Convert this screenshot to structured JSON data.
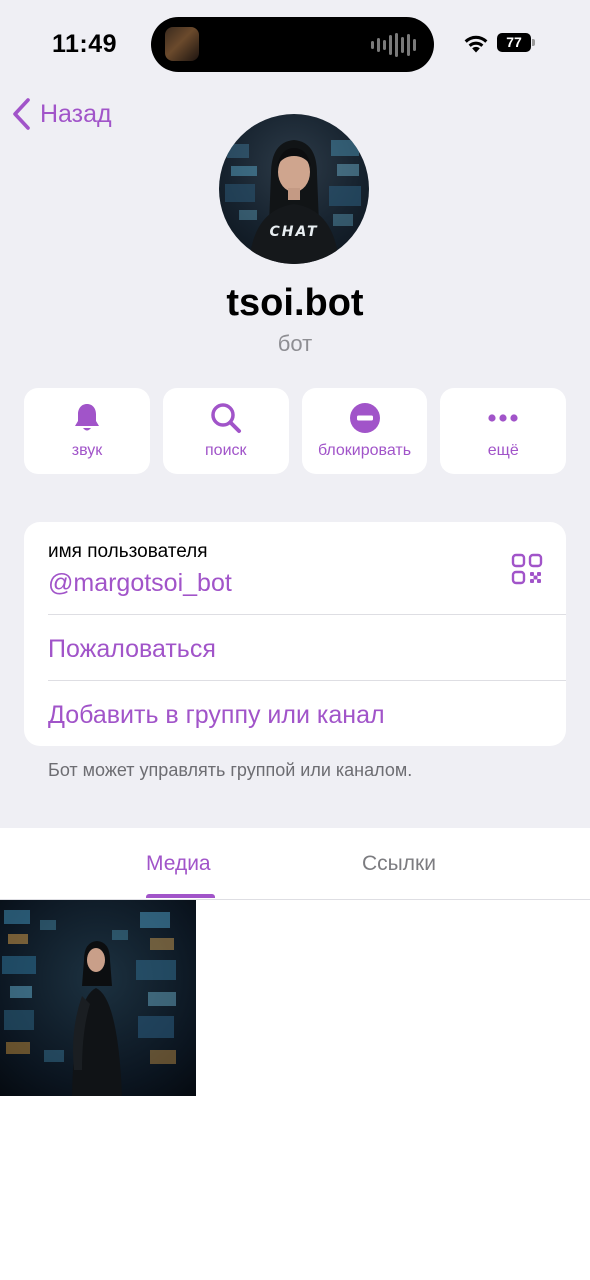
{
  "status_bar": {
    "time": "11:49",
    "battery": "77"
  },
  "nav": {
    "back_label": "Назад"
  },
  "profile": {
    "name": "tsoi.bot",
    "subtitle": "бот",
    "avatar_text": "CHAT"
  },
  "actions": [
    {
      "label": "звук",
      "icon": "bell-icon"
    },
    {
      "label": "поиск",
      "icon": "search-icon"
    },
    {
      "label": "блокировать",
      "icon": "block-icon"
    },
    {
      "label": "ещё",
      "icon": "more-icon"
    }
  ],
  "info": {
    "username_label": "имя пользователя",
    "username_value": "@margotsoi_bot",
    "report_label": "Пожаловаться",
    "add_label": "Добавить в группу или канал"
  },
  "note": "Бот может управлять группой или каналом.",
  "tabs": [
    {
      "label": "Медиа",
      "active": true
    },
    {
      "label": "Ссылки",
      "active": false
    }
  ],
  "colors": {
    "accent": "#a154c9",
    "background": "#efeff4",
    "secondary_text": "#8e8e93"
  }
}
